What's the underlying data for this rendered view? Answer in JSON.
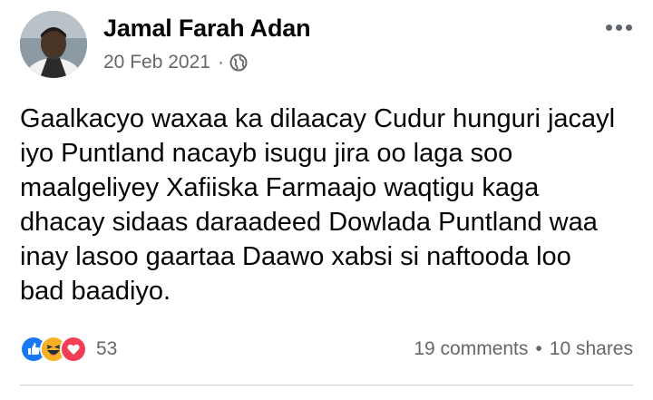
{
  "post": {
    "author": "Jamal Farah Adan",
    "date": "20 Feb 2021",
    "separator": "·",
    "privacy_icon": "globe-icon",
    "more_icon": "more-options-icon",
    "text": "Gaalkacyo waxaa ka dilaacay Cudur hunguri jacayl\niyo Puntland nacayb isugu jira oo laga soo\nmaalgeliyey Xafiiska Farmaajo waqtigu kaga\ndhacay sidaas daraadeed Dowlada Puntland waa\ninay lasoo gaartaa Daawo xabsi si naftooda loo\nbad baadiyo."
  },
  "footer": {
    "reaction_icons": [
      "like-icon",
      "haha-icon",
      "love-icon"
    ],
    "reaction_count": "53",
    "comments": "19 comments",
    "stats_separator": "•",
    "shares": "10 shares"
  },
  "colors": {
    "like": "#1877f2",
    "haha": "#f7b125",
    "love": "#f33e58",
    "secondary_text": "#65676b"
  }
}
